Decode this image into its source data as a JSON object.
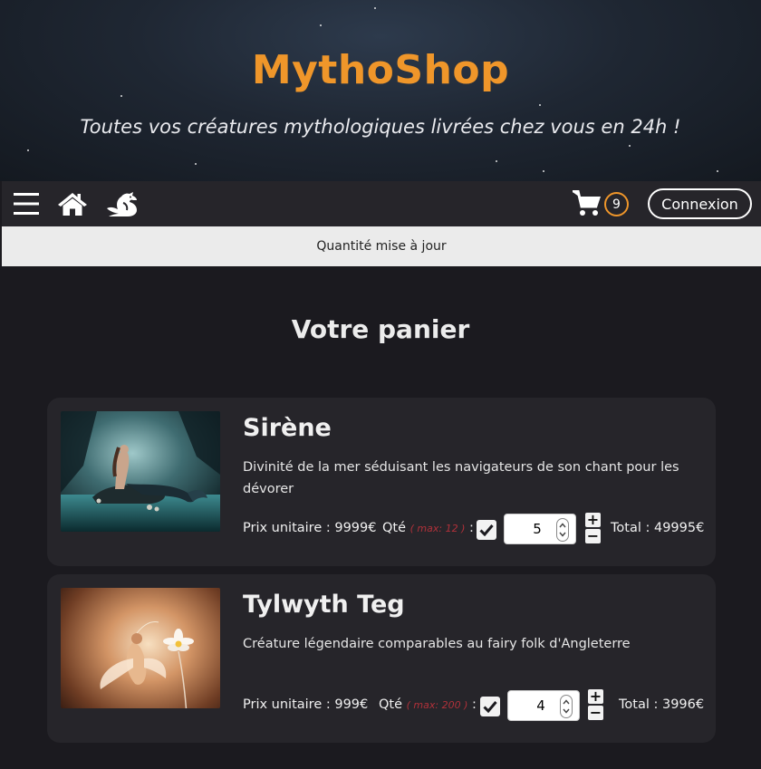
{
  "header": {
    "title": "MythoShop",
    "tagline": "Toutes vos créatures mythologiques livrées chez vous en 24h !"
  },
  "nav": {
    "menu_icon": "hamburger-menu-icon",
    "home_icon": "home-icon",
    "creatures_icon": "dragon-icon",
    "cart_icon": "shopping-cart-icon",
    "cart_count": "9",
    "login_label": "Connexion"
  },
  "status": {
    "message": "Quantité mise à jour"
  },
  "cart": {
    "title": "Votre panier",
    "items": [
      {
        "name": "Sirène",
        "description": "Divinité de la mer séduisant les navigateurs de son chant pour les dévorer",
        "price_label": "Prix unitaire : 9999€",
        "qty_label": "Qté",
        "qty_max": "( max: 12 )",
        "qty_colon": ":",
        "quantity": "5",
        "total_label": "Total : 49995€"
      },
      {
        "name": "Tylwyth Teg",
        "description": "Créature légendaire comparables au fairy folk d'Angleterre",
        "price_label": "Prix unitaire : 999€",
        "qty_label": "Qté",
        "qty_max": "( max: 200 )",
        "qty_colon": ":",
        "quantity": "4",
        "total_label": "Total : 3996€"
      }
    ]
  },
  "colors": {
    "brand": "#ef962a",
    "background": "#1b1a1f",
    "card": "#26252a",
    "max_text": "#b0313a"
  }
}
